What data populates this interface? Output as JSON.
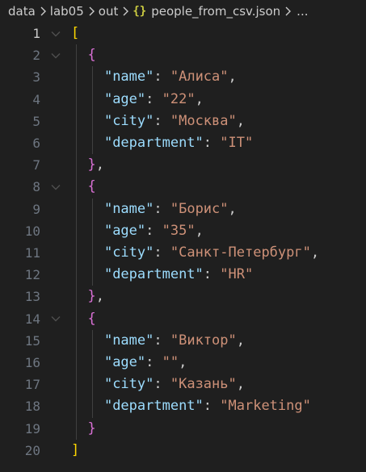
{
  "breadcrumb": {
    "items": [
      "data",
      "lab05",
      "out"
    ],
    "file_icon": "{}",
    "file_name": "people_from_csv.json",
    "overflow": "..."
  },
  "editor": {
    "active_line": 1,
    "lines": [
      {
        "n": "1",
        "fold": true,
        "tokens": [
          {
            "t": "[",
            "c": "b1"
          }
        ]
      },
      {
        "n": "2",
        "fold": true,
        "tokens": [
          {
            "t": "  "
          },
          {
            "t": "{",
            "c": "b2"
          }
        ]
      },
      {
        "n": "3",
        "fold": false,
        "tokens": [
          {
            "t": "    "
          },
          {
            "t": "\"name\"",
            "c": "k"
          },
          {
            "t": ": ",
            "c": "p"
          },
          {
            "t": "\"Алиса\"",
            "c": "s"
          },
          {
            "t": ",",
            "c": "p"
          }
        ]
      },
      {
        "n": "4",
        "fold": false,
        "tokens": [
          {
            "t": "    "
          },
          {
            "t": "\"age\"",
            "c": "k"
          },
          {
            "t": ": ",
            "c": "p"
          },
          {
            "t": "\"22\"",
            "c": "s"
          },
          {
            "t": ",",
            "c": "p"
          }
        ]
      },
      {
        "n": "5",
        "fold": false,
        "tokens": [
          {
            "t": "    "
          },
          {
            "t": "\"city\"",
            "c": "k"
          },
          {
            "t": ": ",
            "c": "p"
          },
          {
            "t": "\"Москва\"",
            "c": "s"
          },
          {
            "t": ",",
            "c": "p"
          }
        ]
      },
      {
        "n": "6",
        "fold": false,
        "tokens": [
          {
            "t": "    "
          },
          {
            "t": "\"department\"",
            "c": "k"
          },
          {
            "t": ": ",
            "c": "p"
          },
          {
            "t": "\"IT\"",
            "c": "s"
          }
        ]
      },
      {
        "n": "7",
        "fold": false,
        "tokens": [
          {
            "t": "  "
          },
          {
            "t": "}",
            "c": "b2"
          },
          {
            "t": ",",
            "c": "p"
          }
        ]
      },
      {
        "n": "8",
        "fold": true,
        "tokens": [
          {
            "t": "  "
          },
          {
            "t": "{",
            "c": "b2"
          }
        ]
      },
      {
        "n": "9",
        "fold": false,
        "tokens": [
          {
            "t": "    "
          },
          {
            "t": "\"name\"",
            "c": "k"
          },
          {
            "t": ": ",
            "c": "p"
          },
          {
            "t": "\"Борис\"",
            "c": "s"
          },
          {
            "t": ",",
            "c": "p"
          }
        ]
      },
      {
        "n": "10",
        "fold": false,
        "tokens": [
          {
            "t": "    "
          },
          {
            "t": "\"age\"",
            "c": "k"
          },
          {
            "t": ": ",
            "c": "p"
          },
          {
            "t": "\"35\"",
            "c": "s"
          },
          {
            "t": ",",
            "c": "p"
          }
        ]
      },
      {
        "n": "11",
        "fold": false,
        "tokens": [
          {
            "t": "    "
          },
          {
            "t": "\"city\"",
            "c": "k"
          },
          {
            "t": ": ",
            "c": "p"
          },
          {
            "t": "\"Санкт-Петербург\"",
            "c": "s"
          },
          {
            "t": ",",
            "c": "p"
          }
        ]
      },
      {
        "n": "12",
        "fold": false,
        "tokens": [
          {
            "t": "    "
          },
          {
            "t": "\"department\"",
            "c": "k"
          },
          {
            "t": ": ",
            "c": "p"
          },
          {
            "t": "\"HR\"",
            "c": "s"
          }
        ]
      },
      {
        "n": "13",
        "fold": false,
        "tokens": [
          {
            "t": "  "
          },
          {
            "t": "}",
            "c": "b2"
          },
          {
            "t": ",",
            "c": "p"
          }
        ]
      },
      {
        "n": "14",
        "fold": true,
        "tokens": [
          {
            "t": "  "
          },
          {
            "t": "{",
            "c": "b2"
          }
        ]
      },
      {
        "n": "15",
        "fold": false,
        "tokens": [
          {
            "t": "    "
          },
          {
            "t": "\"name\"",
            "c": "k"
          },
          {
            "t": ": ",
            "c": "p"
          },
          {
            "t": "\"Виктор\"",
            "c": "s"
          },
          {
            "t": ",",
            "c": "p"
          }
        ]
      },
      {
        "n": "16",
        "fold": false,
        "tokens": [
          {
            "t": "    "
          },
          {
            "t": "\"age\"",
            "c": "k"
          },
          {
            "t": ": ",
            "c": "p"
          },
          {
            "t": "\"\"",
            "c": "s"
          },
          {
            "t": ",",
            "c": "p"
          }
        ]
      },
      {
        "n": "17",
        "fold": false,
        "tokens": [
          {
            "t": "    "
          },
          {
            "t": "\"city\"",
            "c": "k"
          },
          {
            "t": ": ",
            "c": "p"
          },
          {
            "t": "\"Казань\"",
            "c": "s"
          },
          {
            "t": ",",
            "c": "p"
          }
        ]
      },
      {
        "n": "18",
        "fold": false,
        "tokens": [
          {
            "t": "    "
          },
          {
            "t": "\"department\"",
            "c": "k"
          },
          {
            "t": ": ",
            "c": "p"
          },
          {
            "t": "\"Marketing\"",
            "c": "s"
          }
        ]
      },
      {
        "n": "19",
        "fold": false,
        "tokens": [
          {
            "t": "  "
          },
          {
            "t": "}",
            "c": "b2"
          }
        ]
      },
      {
        "n": "20",
        "fold": false,
        "tokens": [
          {
            "t": "]",
            "c": "b1"
          }
        ]
      }
    ]
  },
  "colors": {
    "background": "#1f1f1f",
    "key": "#9cdcfe",
    "string": "#ce9178",
    "bracket_outer": "#ffd700",
    "brace_inner": "#da70d6",
    "line_number": "#6e7681",
    "line_number_active": "#cccccc"
  },
  "icons": {
    "separator": "chevron-right-icon",
    "fold": "chevron-down-icon",
    "file": "json-file-icon"
  }
}
